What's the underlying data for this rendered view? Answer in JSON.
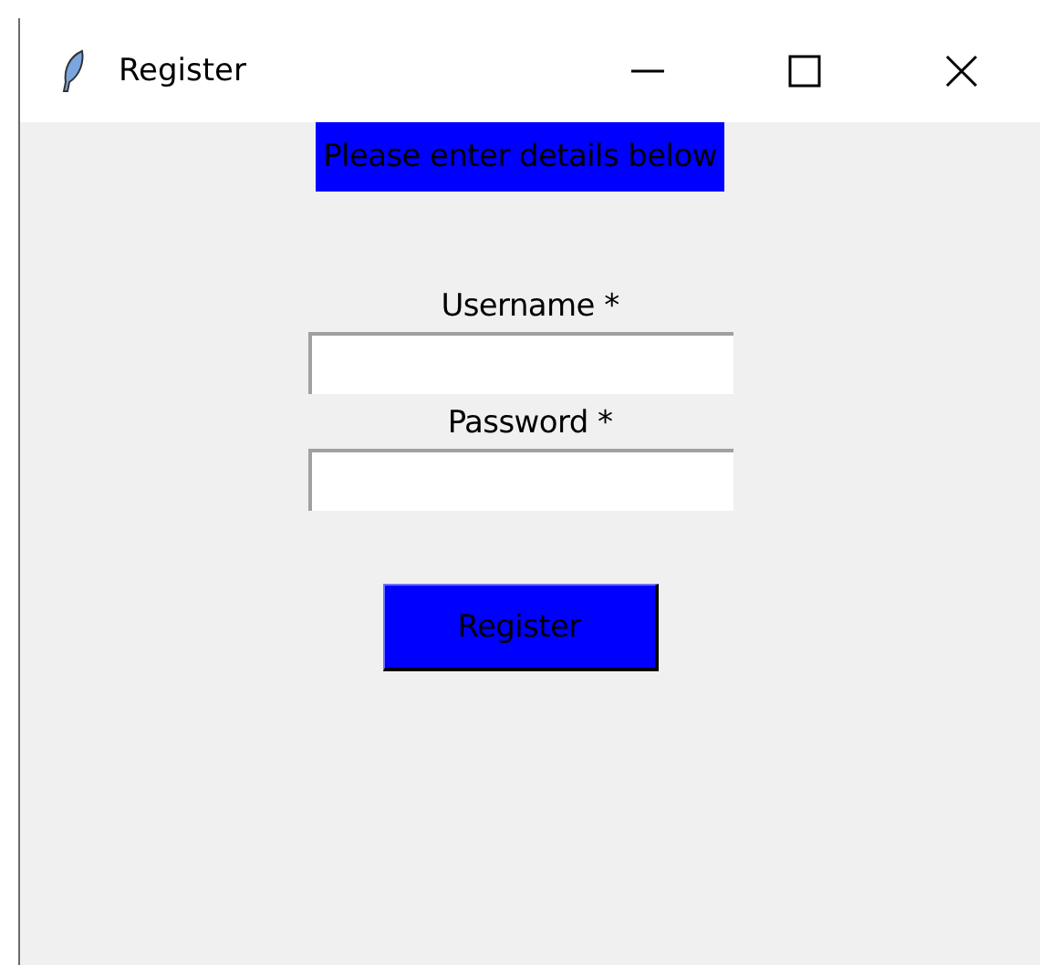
{
  "window": {
    "title": "Register"
  },
  "heading": "Please enter details below",
  "fields": [
    {
      "label": "Username *"
    },
    {
      "label": "Password *"
    }
  ],
  "button": "Register"
}
